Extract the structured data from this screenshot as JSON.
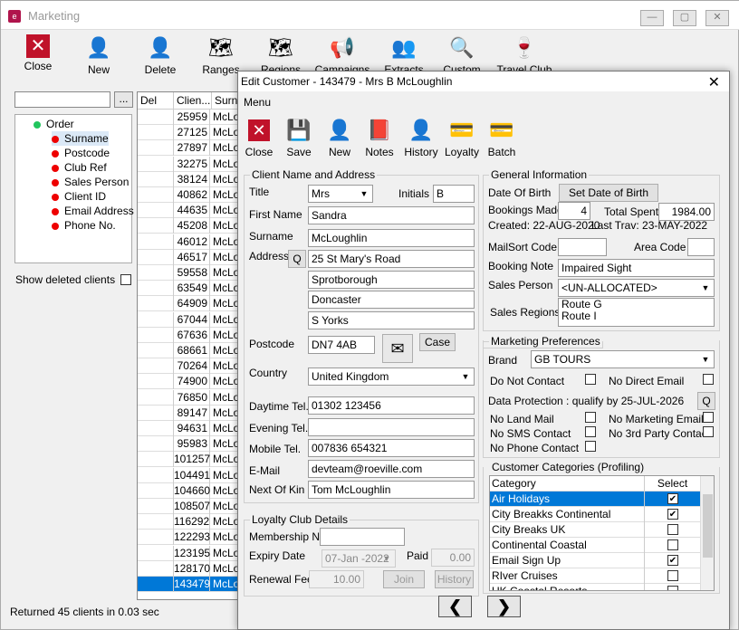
{
  "main": {
    "title": "Marketing",
    "toolbar": [
      "Close",
      "New",
      "Delete",
      "Ranges",
      "Regions",
      "Campaigns",
      "Extracts",
      "Custom",
      "Travel Club"
    ],
    "search_btn": "...",
    "tree": {
      "root": "Order",
      "items": [
        "Surname",
        "Postcode",
        "Club Ref",
        "Sales Person",
        "Client ID",
        "Email Address",
        "Phone No."
      ]
    },
    "show_deleted": "Show deleted clients",
    "grid": {
      "headers": [
        "Del",
        "Clien...",
        "Surna"
      ],
      "ids": [
        "25959",
        "27125",
        "27897",
        "32275",
        "38124",
        "40862",
        "44635",
        "45208",
        "46012",
        "46517",
        "59558",
        "63549",
        "64909",
        "67044",
        "67636",
        "68661",
        "70264",
        "74900",
        "76850",
        "89147",
        "94631",
        "95983",
        "101257",
        "104491",
        "104660",
        "108507",
        "116292",
        "122293",
        "123195",
        "128170",
        "143479"
      ],
      "name_short": "McLo"
    },
    "status": "Returned 45 clients in 0.03 sec"
  },
  "dialog": {
    "title": "Edit Customer - 143479 - Mrs B McLoughlin",
    "menu": "Menu",
    "toolbar": [
      "Close",
      "Save",
      "New",
      "Notes",
      "History",
      "Loyalty",
      "Batch"
    ],
    "client": {
      "legend": "Client Name and Address",
      "title_label": "Title",
      "title": "Mrs",
      "initials_label": "Initials",
      "initials": "B",
      "first_label": "First Name",
      "first": "Sandra",
      "surname_label": "Surname",
      "surname": "McLoughlin",
      "address_label": "Address",
      "q": "Q",
      "addr1": "25 St Mary's Road",
      "addr2": "Sprotborough",
      "addr3": "Doncaster",
      "addr4": "S Yorks",
      "postcode_label": "Postcode",
      "postcode": "DN7 4AB",
      "case_btn": "Case",
      "country_label": "Country",
      "country": "United Kingdom",
      "day_label": "Daytime Tel.",
      "day": "01302 123456",
      "eve_label": "Evening Tel.",
      "eve": "",
      "mob_label": "Mobile Tel.",
      "mob": "007836 654321",
      "email_label": "E-Mail",
      "email": "devteam@roeville.com",
      "kin_label": "Next Of Kin",
      "kin": "Tom McLoughlin"
    },
    "loyalty": {
      "legend": "Loyalty Club Details",
      "member_label": "Membership No.",
      "member": "",
      "expiry_label": "Expiry Date",
      "expiry": "07-Jan -2022",
      "paid_label": "Paid",
      "paid": "0.00",
      "fee_label": "Renewal Fee",
      "fee": "10.00",
      "join_btn": "Join",
      "history_btn": "History"
    },
    "general": {
      "legend": "General Information",
      "dob_label": "Date Of Birth",
      "dob_btn": "Set Date of Birth",
      "bookings_label": "Bookings Made",
      "bookings": "4",
      "spent_label": "Total Spent",
      "spent": "1984.00",
      "created": "Created: 22-AUG-2020",
      "last": "Last Trav: 23-MAY-2022",
      "mailsort_label": "MailSort Code",
      "area_label": "Area Code",
      "note_label": "Booking Note",
      "note": "Impaired Sight",
      "sp_label": "Sales Person",
      "sp": "<UN-ALLOCATED>",
      "regions_label": "Sales Regions",
      "regions": [
        "Route G",
        "Route I"
      ]
    },
    "marketing": {
      "legend": "Marketing Preferences",
      "brand_label": "Brand",
      "brand": "GB TOURS",
      "dnc": "Do Not Contact",
      "dne": "No Direct Email",
      "dp": "Data Protection : qualify by 25-JUL-2026",
      "q": "Q",
      "nlm": "No Land Mail",
      "nme": "No Marketing Email",
      "nsms": "No SMS Contact",
      "n3p": "No 3rd Party Contact",
      "nph": "No Phone Contact"
    },
    "categories": {
      "legend": "Customer Categories (Profiling)",
      "col_cat": "Category",
      "col_sel": "Select",
      "rows": [
        {
          "name": "Air Holidays",
          "checked": true
        },
        {
          "name": "City Breakks Continental",
          "checked": true
        },
        {
          "name": "City Breaks UK",
          "checked": false
        },
        {
          "name": "Continental Coastal",
          "checked": false
        },
        {
          "name": "Email Sign Up",
          "checked": true
        },
        {
          "name": "RIver Cruises",
          "checked": false
        },
        {
          "name": "UK Coastal Resorts",
          "checked": false
        }
      ]
    },
    "nav": {
      "prev": "❮",
      "next": "❯"
    }
  },
  "colors": {
    "accent": "#0078d7",
    "red": "#c0122a",
    "green": "#22c55e"
  }
}
